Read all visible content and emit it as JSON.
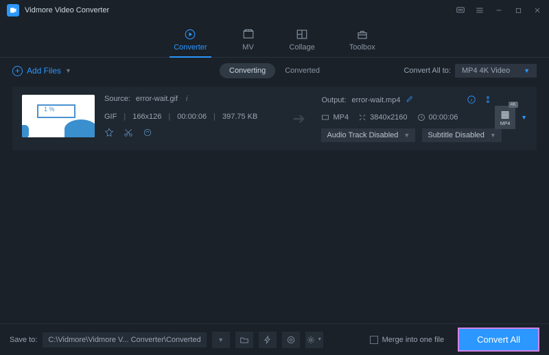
{
  "app_title": "Vidmore Video Converter",
  "tabs": {
    "converter": "Converter",
    "mv": "MV",
    "collage": "Collage",
    "toolbox": "Toolbox"
  },
  "toolbar": {
    "add_files": "Add Files",
    "converting": "Converting",
    "converted": "Converted",
    "convert_all_to": "Convert All to:",
    "format_selected": "MP4 4K Video"
  },
  "item": {
    "source_label": "Source:",
    "source_name": "error-wait.gif",
    "codec": "GIF",
    "dims": "166x126",
    "dur": "00:00:06",
    "size": "397.75 KB",
    "output_label": "Output:",
    "output_name": "error-wait.mp4",
    "out_codec": "MP4",
    "out_dims": "3840x2160",
    "out_dur": "00:00:06",
    "audio_dd": "Audio Track Disabled",
    "subtitle_dd": "Subtitle Disabled",
    "fmt_k": "4K",
    "fmt_lbl": "MP4"
  },
  "footer": {
    "save_to": "Save to:",
    "path": "C:\\Vidmore\\Vidmore V... Converter\\Converted",
    "merge": "Merge into one file",
    "convert_all": "Convert All"
  }
}
